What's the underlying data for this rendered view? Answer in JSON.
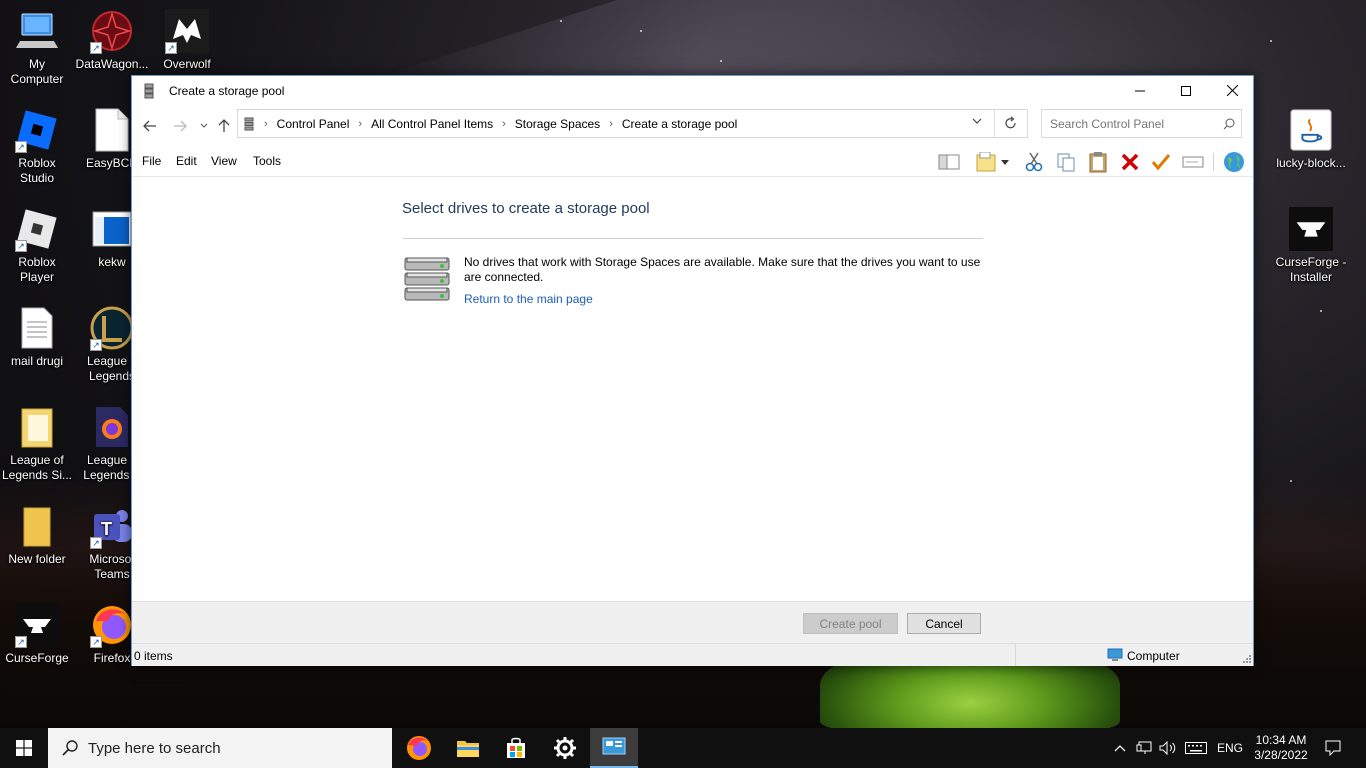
{
  "desktop": {
    "icons_left": [
      {
        "label": "My\nComputer",
        "icon": "computer-icon"
      },
      {
        "label": "DataWagon...",
        "icon": "datawagon-icon"
      },
      {
        "label": "Overwolf",
        "icon": "overwolf-icon"
      },
      {
        "label": "Roblox\nStudio",
        "icon": "roblox-studio-icon"
      },
      {
        "label": "EasyBCD",
        "icon": "document-icon"
      },
      {
        "label": "Roblox\nPlayer",
        "icon": "roblox-player-icon"
      },
      {
        "label": "kekw",
        "icon": "kekw-icon"
      },
      {
        "label": "mail drugi",
        "icon": "text-file-icon"
      },
      {
        "label": "League o\nLegends",
        "icon": "league-icon"
      },
      {
        "label": "League of\nLegends Si...",
        "icon": "folder-icon"
      },
      {
        "label": "League o\nLegends S",
        "icon": "firefox-folder-icon"
      },
      {
        "label": "New folder",
        "icon": "folder-icon"
      },
      {
        "label": "Microsof\nTeams",
        "icon": "teams-icon"
      },
      {
        "label": "CurseForge",
        "icon": "curseforge-icon"
      },
      {
        "label": "Firefox",
        "icon": "firefox-icon"
      }
    ],
    "icons_right": [
      {
        "label": "lucky-block...",
        "icon": "java-icon"
      },
      {
        "label": "CurseForge -\nInstaller",
        "icon": "curseforge-icon"
      }
    ]
  },
  "window": {
    "title": "Create a storage pool",
    "address": {
      "crumbs": [
        "Control Panel",
        "All Control Panel Items",
        "Storage Spaces",
        "Create a storage pool"
      ]
    },
    "search_placeholder": "Search Control Panel",
    "menu": [
      "File",
      "Edit",
      "View",
      "Tools"
    ],
    "content": {
      "heading": "Select drives to create a storage pool",
      "message": "No drives that work with Storage Spaces are available. Make sure that the drives you want to use are connected.",
      "link": "Return to the main page"
    },
    "buttons": {
      "create_pool": "Create pool",
      "cancel": "Cancel"
    },
    "status": {
      "items": "0 items",
      "location": "Computer"
    }
  },
  "taskbar": {
    "search_placeholder": "Type here to search",
    "language": "ENG",
    "time": "10:34 AM",
    "date": "3/28/2022"
  }
}
